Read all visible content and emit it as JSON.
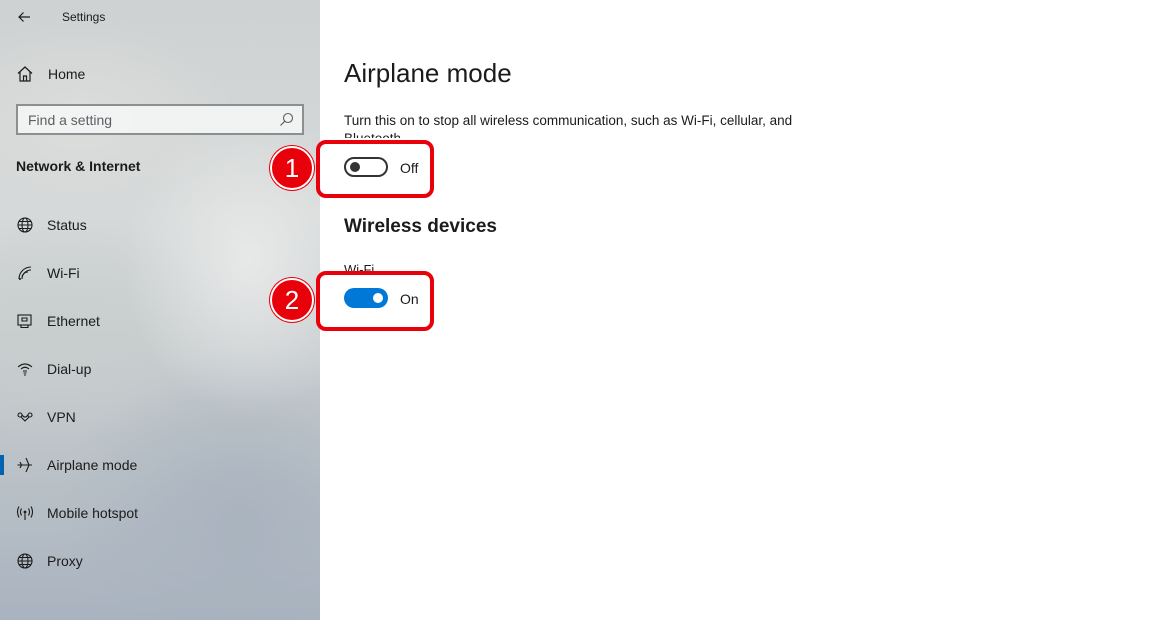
{
  "window": {
    "title": "Settings"
  },
  "sidebar": {
    "home_label": "Home",
    "search_placeholder": "Find a setting",
    "section_title": "Network & Internet",
    "items": [
      {
        "label": "Status",
        "icon": "globe-icon",
        "selected": false
      },
      {
        "label": "Wi-Fi",
        "icon": "wifi-icon",
        "selected": false
      },
      {
        "label": "Ethernet",
        "icon": "ethernet-icon",
        "selected": false
      },
      {
        "label": "Dial-up",
        "icon": "dialup-icon",
        "selected": false
      },
      {
        "label": "VPN",
        "icon": "vpn-icon",
        "selected": false
      },
      {
        "label": "Airplane mode",
        "icon": "airplane-icon",
        "selected": true
      },
      {
        "label": "Mobile hotspot",
        "icon": "hotspot-icon",
        "selected": false
      },
      {
        "label": "Proxy",
        "icon": "globe-icon",
        "selected": false
      }
    ]
  },
  "main": {
    "title": "Airplane mode",
    "description": "Turn this on to stop all wireless communication, such as Wi-Fi, cellular, and Bluetooth",
    "airplane_toggle": {
      "state": "Off",
      "on": false
    },
    "wireless_title": "Wireless devices",
    "wifi_label": "Wi-Fi",
    "wifi_toggle": {
      "state": "On",
      "on": true
    }
  },
  "annotations": [
    {
      "number": "1"
    },
    {
      "number": "2"
    }
  ],
  "colors": {
    "accent": "#0078d7",
    "selection_bar": "#0063b1",
    "annotation": "#e8000b"
  }
}
